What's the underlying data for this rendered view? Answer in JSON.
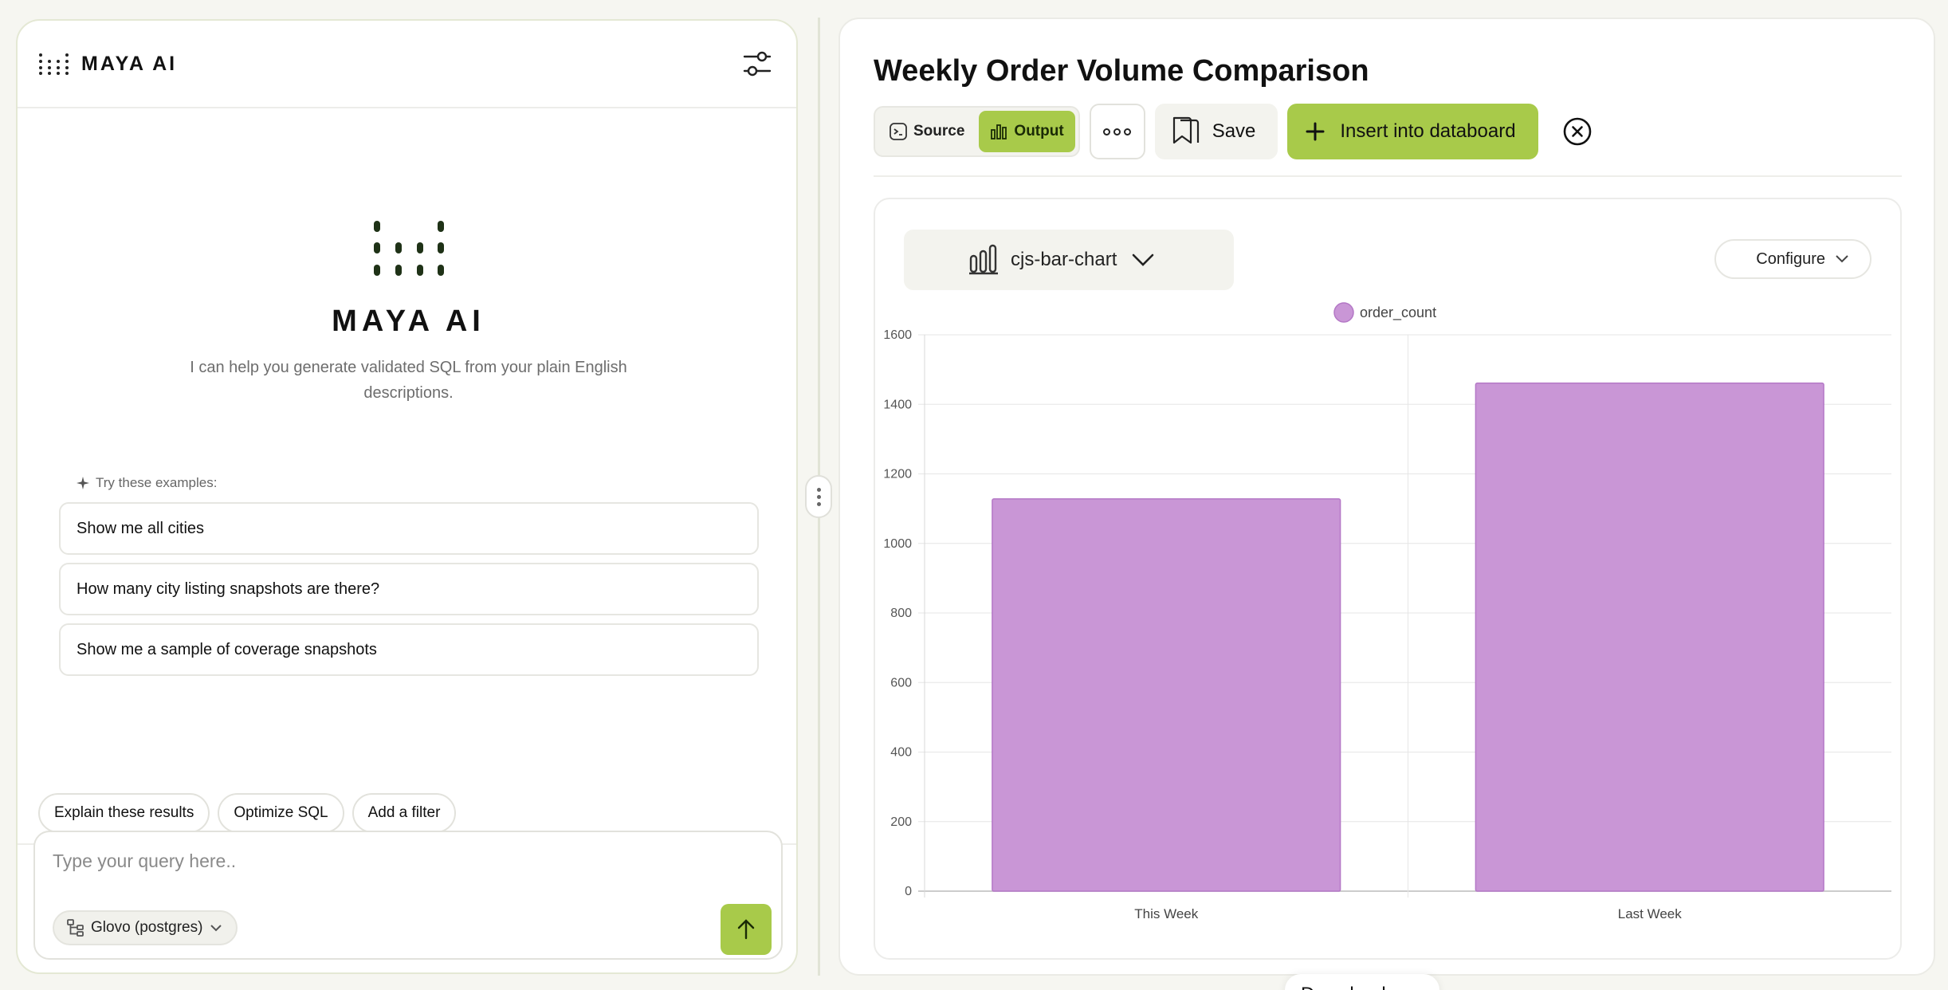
{
  "brand": {
    "name": "MAYA AI"
  },
  "hero": {
    "title": "MAYA AI",
    "description": "I can help you generate validated SQL from your plain English descriptions."
  },
  "examples": {
    "label": "Try these examples:",
    "items": [
      "Show me all cities",
      "How many city listing snapshots are there?",
      "Show me a sample of coverage snapshots"
    ]
  },
  "suggestions": [
    "Explain these results",
    "Optimize SQL",
    "Add a filter"
  ],
  "composer": {
    "placeholder": "Type your query here..",
    "database": "Glovo (postgres)"
  },
  "panel": {
    "title": "Weekly Order Volume Comparison",
    "tabs": {
      "source": "Source",
      "output": "Output"
    },
    "save_label": "Save",
    "insert_label": "Insert into databoard",
    "chart_type": "cjs-bar-chart",
    "configure_label": "Configure",
    "bottom_clipped_label": "Download"
  },
  "colors": {
    "accent": "#a8ca4a",
    "bar_fill": "#c996d6",
    "bar_stroke": "#b478c6"
  },
  "chart_data": {
    "type": "bar",
    "categories": [
      "This Week",
      "Last Week"
    ],
    "series": [
      {
        "name": "order_count",
        "values": [
          1128,
          1461
        ]
      }
    ],
    "ylim": [
      0,
      1600
    ],
    "yticks": [
      0,
      200,
      400,
      600,
      800,
      1000,
      1200,
      1400,
      1600
    ],
    "legend": "top-center",
    "grid": true,
    "xlabel": "",
    "ylabel": ""
  }
}
